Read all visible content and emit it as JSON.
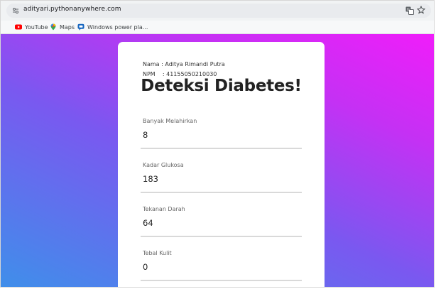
{
  "browser": {
    "url": "adityari.pythonanywhere.com",
    "bookmarks": [
      {
        "label": "YouTube",
        "icon": "youtube-icon"
      },
      {
        "label": "Maps",
        "icon": "maps-icon"
      },
      {
        "label": "Windows power pla...",
        "icon": "windows-chat-icon"
      }
    ]
  },
  "page": {
    "nama": "Nama : Aditya Rimandi Putra",
    "npm": "NPM    : 41155050210030",
    "title": "Deteksi Diabetes!",
    "fields": [
      {
        "label": "Banyak Melahirkan",
        "value": "8"
      },
      {
        "label": "Kadar Glukosa",
        "value": "183"
      },
      {
        "label": "Tekanan Darah",
        "value": "64"
      },
      {
        "label": "Tebal Kulit",
        "value": "0"
      }
    ]
  },
  "colors": {
    "gradient_start": "#3f8fea",
    "gradient_end": "#f01dfa",
    "card": "#ffffff"
  }
}
